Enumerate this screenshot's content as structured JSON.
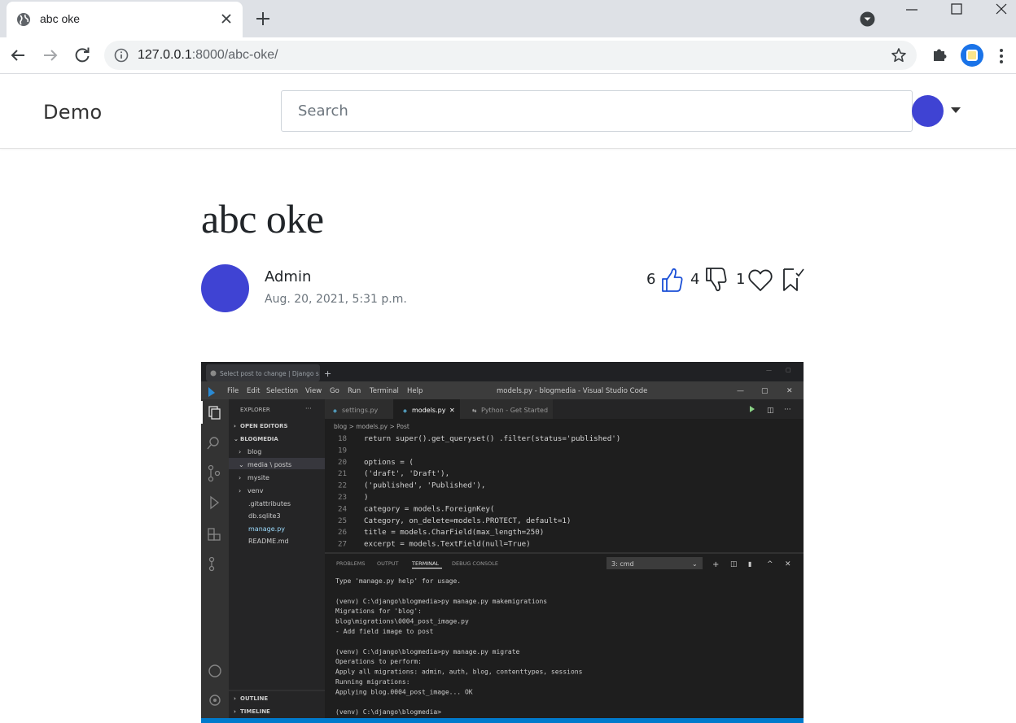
{
  "browser": {
    "tab_title": "abc oke",
    "url_host": "127.0.0.1",
    "url_rest": ":8000/abc-oke/"
  },
  "navbar": {
    "brand": "Demo",
    "search_placeholder": "Search"
  },
  "post": {
    "title": "abc oke",
    "author": "Admin",
    "date": "Aug. 20, 2021, 5:31 p.m.",
    "reactions": {
      "likes": "6",
      "dislikes": "4",
      "hearts": "1"
    }
  },
  "colors": {
    "avatar": "#3f43d3",
    "like_icon": "#1a4fd6"
  },
  "screenshot": {
    "browser_tab": "Select post to change | Django s",
    "menu": [
      "File",
      "Edit",
      "Selection",
      "View",
      "Go",
      "Run",
      "Terminal",
      "Help"
    ],
    "window_title": "models.py - blogmedia - Visual Studio Code",
    "explorer_label": "EXPLORER",
    "open_editors": "OPEN EDITORS",
    "project": "BLOGMEDIA",
    "tree": [
      "blog",
      "media \\ posts",
      "mysite",
      "venv",
      ".gitattributes",
      "db.sqlite3",
      "manage.py",
      "README.md"
    ],
    "outline": "OUTLINE",
    "timeline": "TIMELINE",
    "tabs": [
      "settings.py",
      "models.py",
      "Python - Get Started"
    ],
    "breadcrumb": "blog  >  models.py  >  Post",
    "code": [
      {
        "n": "18",
        "t": "            return super().get_queryset() .filter(status='published')"
      },
      {
        "n": "19",
        "t": ""
      },
      {
        "n": "20",
        "t": "    options = ("
      },
      {
        "n": "21",
        "t": "        ('draft', 'Draft'),"
      },
      {
        "n": "22",
        "t": "        ('published', 'Published'),"
      },
      {
        "n": "23",
        "t": "    )"
      },
      {
        "n": "24",
        "t": "    category = models.ForeignKey("
      },
      {
        "n": "25",
        "t": "        Category, on_delete=models.PROTECT, default=1)"
      },
      {
        "n": "26",
        "t": "    title = models.CharField(max_length=250)"
      },
      {
        "n": "27",
        "t": "    excerpt = models.TextField(null=True)"
      }
    ],
    "panel_tabs": [
      "PROBLEMS",
      "OUTPUT",
      "TERMINAL",
      "DEBUG CONSOLE"
    ],
    "terminal_select": "3: cmd",
    "terminal": [
      "Type 'manage.py help' for usage.",
      "",
      "(venv) C:\\django\\blogmedia>py manage.py makemigrations",
      "Migrations for 'blog':",
      "  blog\\migrations\\0004_post_image.py",
      "    - Add field image to post",
      "",
      "(venv) C:\\django\\blogmedia>py manage.py migrate",
      "Operations to perform:",
      "  Apply all migrations: admin, auth, blog, contenttypes, sessions",
      "Running migrations:",
      "  Applying blog.0004_post_image... OK",
      "",
      "(venv) C:\\django\\blogmedia>"
    ]
  }
}
